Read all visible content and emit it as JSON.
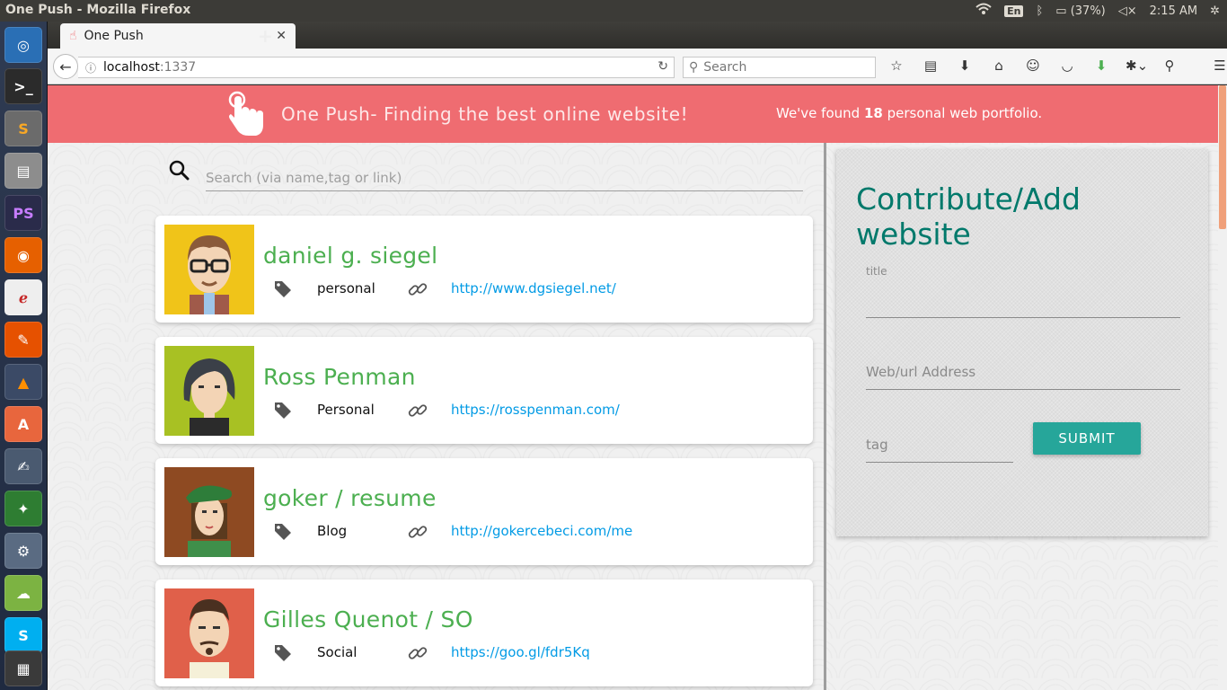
{
  "system": {
    "window_title": "One Push - Mozilla Firefox",
    "language": "En",
    "battery": "(37%)",
    "time": "2:15 AM"
  },
  "browser": {
    "tab_title": "One Push",
    "url_host": "localhost",
    "url_port": ":1337",
    "search_placeholder": "Search"
  },
  "banner": {
    "title": "One Push- Finding the best online website!",
    "found_prefix": "We've found ",
    "found_count": "18",
    "found_suffix": " personal web portfolio."
  },
  "search": {
    "placeholder": "Search (via name,tag or link)"
  },
  "websites": [
    {
      "name": "daniel g. siegel",
      "tag": "personal",
      "link": "http://www.dgsiegel.net/"
    },
    {
      "name": "Ross Penman",
      "tag": "Personal",
      "link": "https://rosspenman.com/"
    },
    {
      "name": "goker / resume",
      "tag": "Blog",
      "link": "http://gokercebeci.com/me"
    },
    {
      "name": "Gilles Quenot / SO",
      "tag": "Social",
      "link": "https://goo.gl/fdr5Kq"
    }
  ],
  "form": {
    "heading": "Contribute/Add website",
    "title_label": "title",
    "url_placeholder": "Web/url Address",
    "tag_placeholder": "tag",
    "submit_label": "SUBMIT"
  },
  "colors": {
    "banner": "#ef6c71",
    "name_green": "#4caf50",
    "link_blue": "#039be5",
    "heading_teal": "#00796b",
    "submit_teal": "#26a69a"
  }
}
